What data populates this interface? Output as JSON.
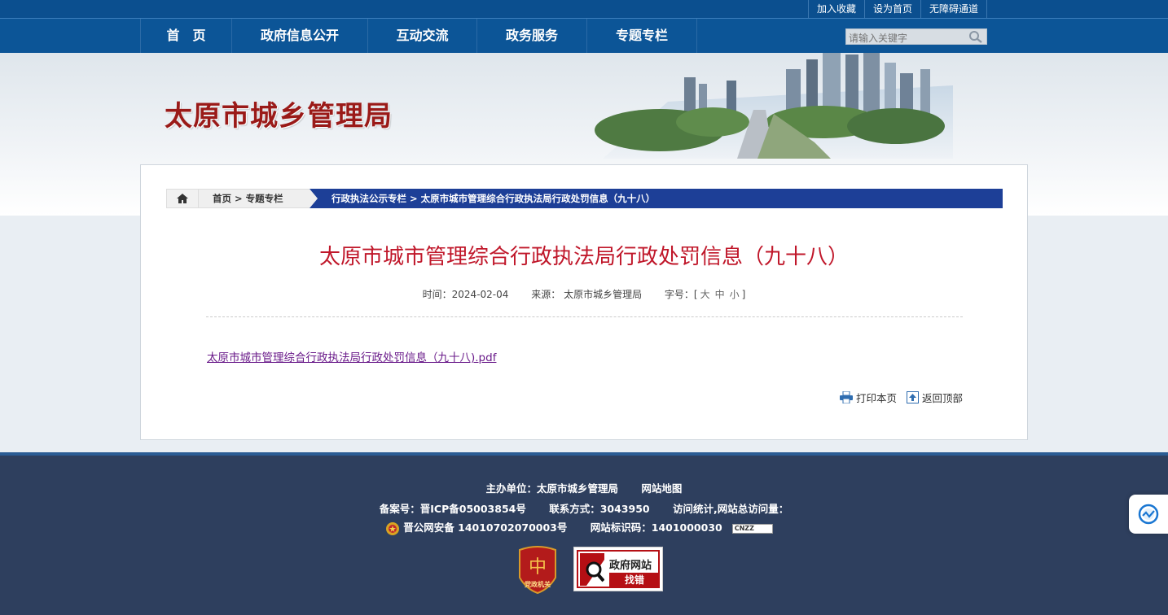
{
  "top_links": [
    "加入收藏",
    "设为首页",
    "无障碍通道"
  ],
  "nav": {
    "items": [
      "首　页",
      "政府信息公开",
      "互动交流",
      "政务服务",
      "专题专栏"
    ],
    "search_placeholder": "请输入关键字"
  },
  "banner": {
    "site_title": "太原市城乡管理局"
  },
  "breadcrumb": {
    "home": "首页",
    "sep": ">",
    "section": "专题专栏",
    "column": "行政执法公示专栏",
    "current": "太原市城市管理综合行政执法局行政处罚信息（九十八）"
  },
  "article": {
    "title": "太原市城市管理综合行政执法局行政处罚信息（九十八）",
    "time_label": "时间：",
    "time_value": "2024-02-04",
    "source_label": "来源：",
    "source_value": "太原市城乡管理局",
    "fontsize_label": "字号：[",
    "fontsize_close": "]",
    "fontsize_options": [
      "大",
      "中",
      "小"
    ],
    "attachment": "太原市城市管理综合行政执法局行政处罚信息（九十八).pdf"
  },
  "tools": {
    "print": "打印本页",
    "top": "返回顶部"
  },
  "footer": {
    "host": "主办单位：太原市城乡管理局",
    "sitemap": "网站地图",
    "icp": "备案号：晋ICP备05003854号",
    "contact": "联系方式：3043950",
    "stats": "访问统计,网站总访问量：",
    "police": "晋公网安备 14010702070003号",
    "site_id": "网站标识码：1401000030",
    "cnzz": "CNZZ",
    "party_badge": "党政机关",
    "gov_badge_top": "政府网站",
    "gov_badge_bottom": "找错"
  },
  "colors": {
    "nav": "#0c5597",
    "title_red": "#c0172a",
    "crumb_blue": "#1d3f97",
    "footer": "#2e3f5e"
  }
}
